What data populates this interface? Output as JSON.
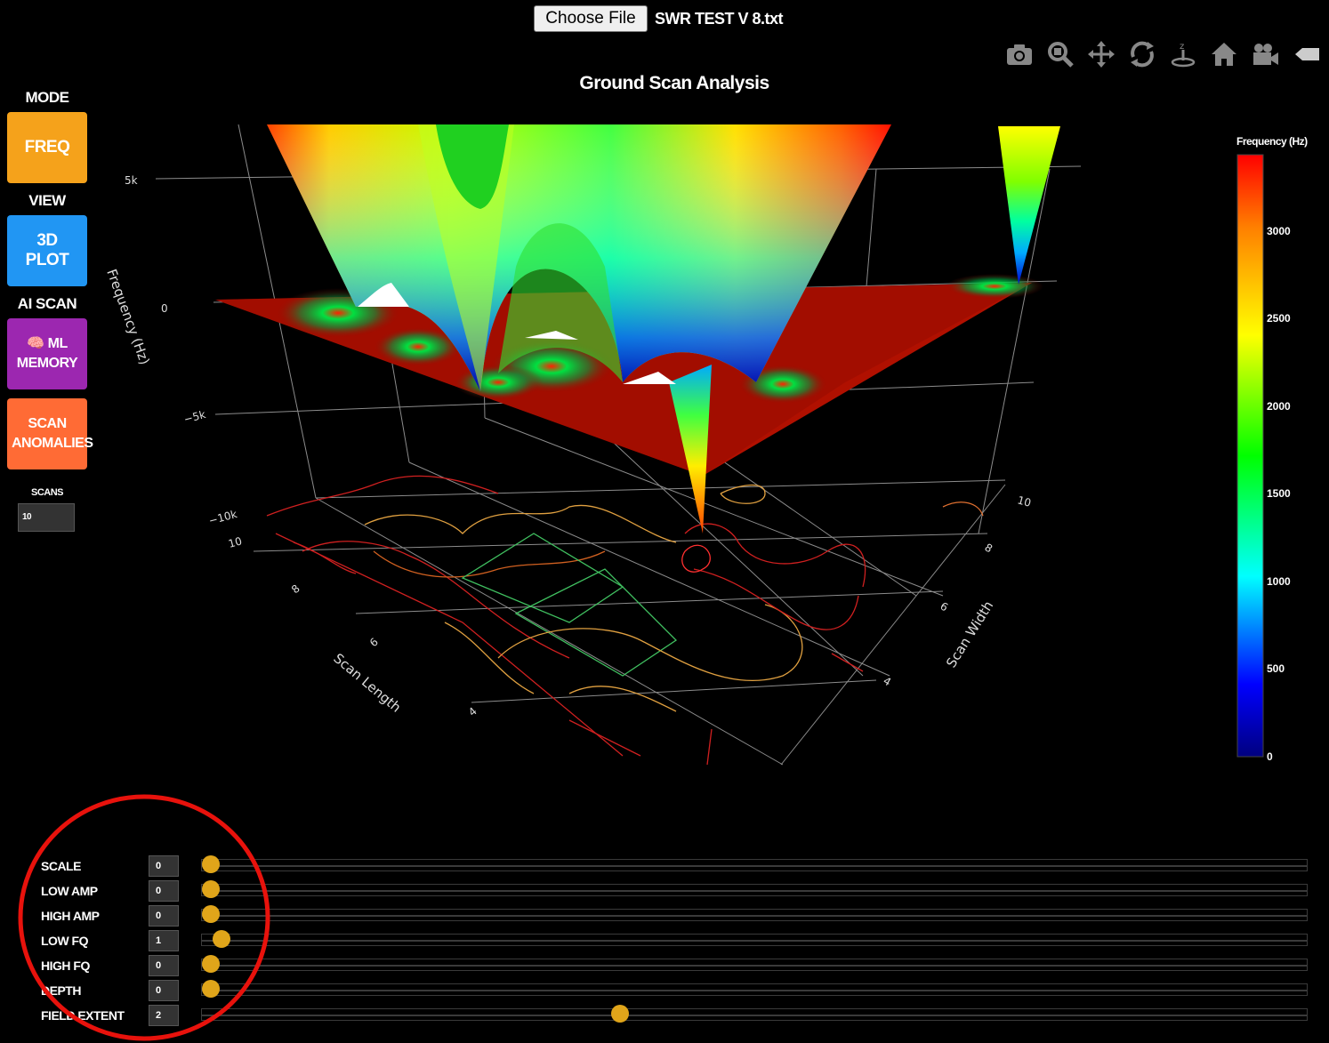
{
  "file": {
    "button_label": "Choose File",
    "filename": "SWR TEST V 8.txt"
  },
  "modebar": [
    {
      "name": "camera-icon"
    },
    {
      "name": "zoom-icon"
    },
    {
      "name": "pan-icon"
    },
    {
      "name": "orbit-rotation-icon"
    },
    {
      "name": "turntable-rotation-icon"
    },
    {
      "name": "reset-camera-icon"
    },
    {
      "name": "video-camera-icon"
    },
    {
      "name": "plotly-logo-icon"
    }
  ],
  "sidebar": {
    "mode_label": "MODE",
    "freq_button": "FREQ",
    "view_label": "VIEW",
    "plot_button": "3D PLOT",
    "ai_label": "AI SCAN",
    "ml_button": "🧠 ML MEMORY",
    "anomalies_button": "SCAN ANOMALIES",
    "scans_label": "SCANS",
    "scans_value": "10"
  },
  "colors": {
    "freq": "#f5a21b",
    "plot": "#2196f3",
    "ml": "#9c27b0",
    "anomalies": "#ff6b35",
    "slider_thumb": "#e0a51a"
  },
  "chart_data": {
    "type": "surface",
    "title": "Ground Scan Analysis",
    "axes": {
      "z": {
        "label": "Frequency (Hz)",
        "ticks": [
          "5k",
          "0",
          "−5k",
          "−10k"
        ]
      },
      "x": {
        "label": "Scan Length",
        "ticks": [
          "10",
          "8",
          "6",
          "4"
        ]
      },
      "y": {
        "label": "Scan Width",
        "ticks": [
          "10",
          "8",
          "6",
          "4"
        ]
      }
    },
    "colorbar": {
      "title": "Frequency (Hz)",
      "ticks": [
        "3000",
        "2500",
        "2000",
        "1500",
        "1000",
        "500",
        "0"
      ],
      "range": [
        0,
        3300
      ],
      "colorscale": "jet"
    },
    "contours_projected": true
  },
  "sliders": [
    {
      "label": "SCALE",
      "value": "0",
      "fraction": 0.0
    },
    {
      "label": "LOW AMP",
      "value": "0",
      "fraction": 0.0
    },
    {
      "label": "HIGH AMP",
      "value": "0",
      "fraction": 0.0
    },
    {
      "label": "LOW FQ",
      "value": "1",
      "fraction": 0.01
    },
    {
      "label": "HIGH FQ",
      "value": "0",
      "fraction": 0.0
    },
    {
      "label": "DEPTH",
      "value": "0",
      "fraction": 0.0
    },
    {
      "label": "FIELD EXTENT",
      "value": "2",
      "fraction": 0.37
    }
  ]
}
